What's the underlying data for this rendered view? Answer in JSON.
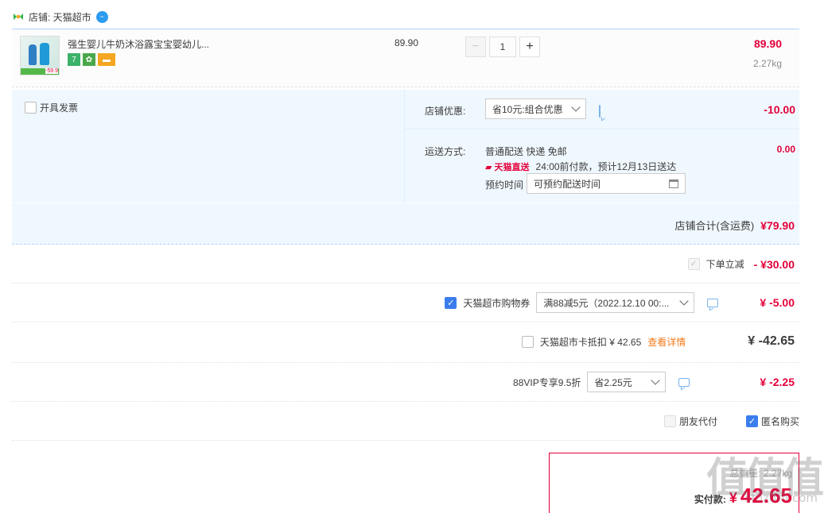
{
  "shop": {
    "label": "店铺: 天猫超市"
  },
  "item": {
    "title": "强生婴儿牛奶沐浴露宝宝婴幼儿...",
    "thumb_tag": "-59.9",
    "badge_7": "7",
    "unit_price": "89.90",
    "quantity": "1",
    "total": "89.90",
    "weight": "2.27kg"
  },
  "invoice": {
    "label": "开具发票"
  },
  "shop_discount": {
    "label": "店铺优惠:",
    "selected": "省10元:组合优惠",
    "amount": "-10.00"
  },
  "delivery": {
    "label": "运送方式:",
    "method": "普通配送 快递 免邮",
    "tmall_tag": "天猫直送",
    "eta": "24:00前付款，预计12月13日送达",
    "reserve_label": "预约时间",
    "reserve_placeholder": "可预约配送时间",
    "amount": "0.00"
  },
  "shop_total": {
    "label": "店铺合计(含运费)",
    "amount": "¥79.90"
  },
  "instant_off": {
    "label": "下单立减",
    "amount": "- ¥30.00"
  },
  "coupon": {
    "label": "天猫超市购物券",
    "selected": "满88减5元（2022.12.10 00:...",
    "amount": "¥ -5.00"
  },
  "card": {
    "label": "天猫超市卡抵扣 ¥ 42.65",
    "link": "查看详情",
    "amount": "¥ -42.65"
  },
  "vip": {
    "label": "88VIP专享9.5折",
    "selected": "省2.25元",
    "amount": "¥ -2.25"
  },
  "friend_pay": {
    "label": "朋友代付"
  },
  "anon": {
    "label": "匿名购买"
  },
  "pay": {
    "weight_label": "总重量: 2.27kg",
    "label": "实付款:",
    "currency": "¥",
    "amount": "42.65"
  },
  "watermark": {
    "text": "值值值",
    "site": "smzdm.com"
  },
  "colors": {
    "accent_red": "#e4003a",
    "accent_blue": "#3b7ded",
    "panel_bg": "#f0f8ff"
  }
}
